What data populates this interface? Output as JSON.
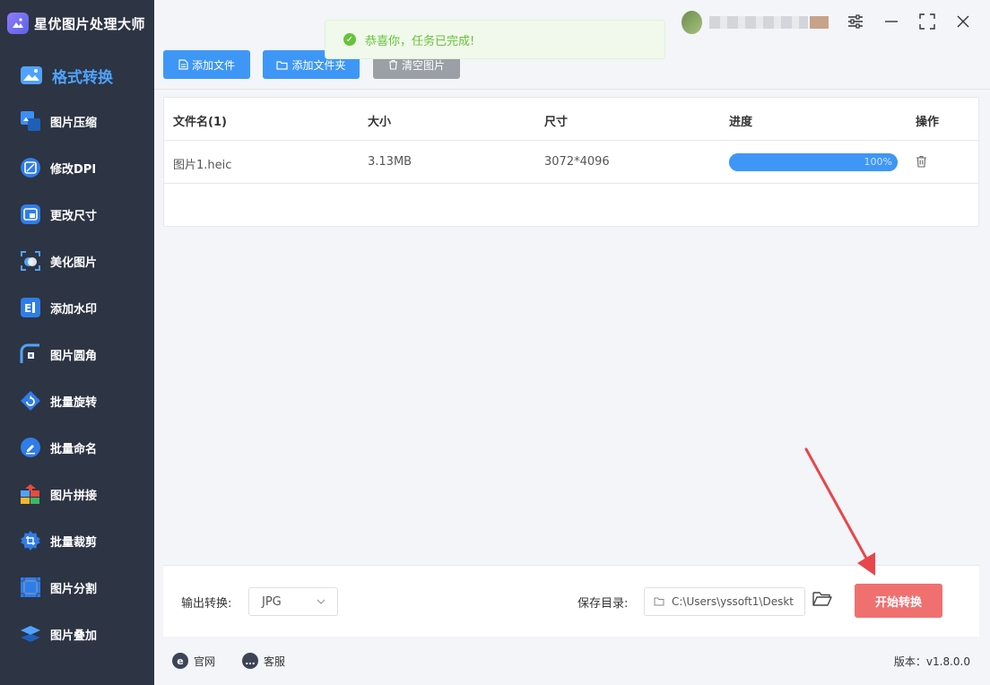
{
  "app": {
    "title": "星优图片处理大师"
  },
  "sidebar": {
    "items": [
      {
        "label": "格式转换",
        "icon": "image-convert-icon"
      },
      {
        "label": "图片压缩",
        "icon": "compress-icon"
      },
      {
        "label": "修改DPI",
        "icon": "dpi-icon"
      },
      {
        "label": "更改尺寸",
        "icon": "resize-icon"
      },
      {
        "label": "美化图片",
        "icon": "beautify-icon"
      },
      {
        "label": "添加水印",
        "icon": "watermark-icon"
      },
      {
        "label": "图片圆角",
        "icon": "rounded-corner-icon"
      },
      {
        "label": "批量旋转",
        "icon": "rotate-icon"
      },
      {
        "label": "批量命名",
        "icon": "rename-icon"
      },
      {
        "label": "图片拼接",
        "icon": "puzzle-icon"
      },
      {
        "label": "批量裁剪",
        "icon": "crop-icon"
      },
      {
        "label": "图片分割",
        "icon": "split-icon"
      },
      {
        "label": "图片叠加",
        "icon": "layers-icon"
      }
    ],
    "active_index": 0
  },
  "toolbar": {
    "add_file": "添加文件",
    "add_folder": "添加文件夹",
    "clear": "清空图片"
  },
  "toast": {
    "message": "恭喜你，任务已完成!"
  },
  "table": {
    "headers": [
      "文件名(1)",
      "大小",
      "尺寸",
      "进度",
      "操作"
    ],
    "rows": [
      {
        "name": "图片1.heic",
        "size": "3.13MB",
        "dimensions": "3072*4096",
        "progress": 100,
        "progress_text": "100%"
      }
    ]
  },
  "bottom": {
    "output_label": "输出转换:",
    "format_value": "JPG",
    "save_label": "保存目录:",
    "save_path": "C:\\Users\\yssoft1\\Deskt",
    "start_label": "开始转换"
  },
  "footer": {
    "website": "官网",
    "support": "客服",
    "version": "版本：v1.8.0.0"
  },
  "colors": {
    "sidebar_bg": "#2d3443",
    "accent": "#3e97f6",
    "start_button": "#f07070",
    "success": "#67c23a",
    "annotation_arrow": "#e8464a"
  }
}
